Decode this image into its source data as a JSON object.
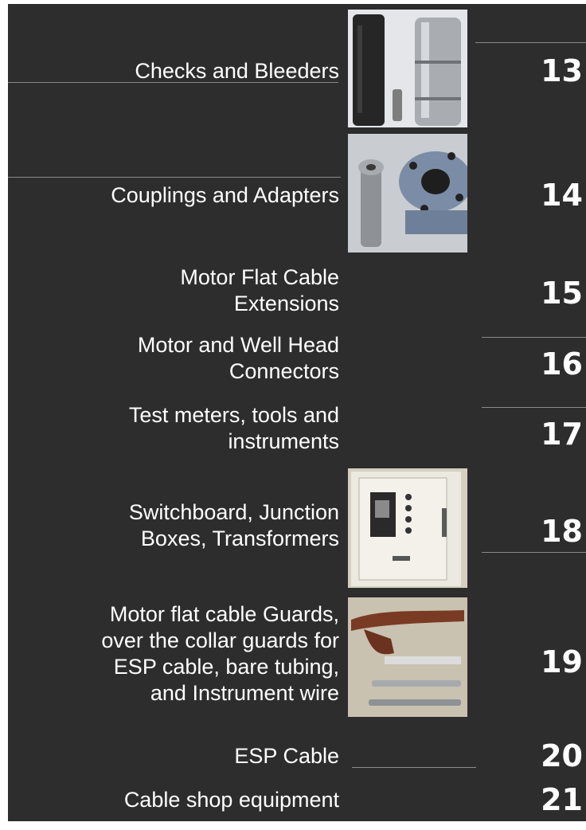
{
  "catalog": {
    "items": [
      {
        "title": "Checks and Bleeders",
        "page": "13",
        "photo": "check-valve-and-bleeder-parts"
      },
      {
        "title": "Couplings and Adapters",
        "page": "14",
        "photo": "coupling-and-flange-adapter"
      },
      {
        "title": "Motor Flat Cable\nExtensions",
        "page": "15"
      },
      {
        "title": "Motor and Well Head\nConnectors",
        "page": "16"
      },
      {
        "title": "Test meters, tools and\ninstruments",
        "page": "17"
      },
      {
        "title": "Switchboard, Junction\nBoxes, Transformers",
        "page": "18",
        "photo": "switchboard-panel"
      },
      {
        "title": "Motor flat cable Guards,\nover the collar guards for\nESP cable, bare tubing,\nand Instrument wire",
        "page": "19",
        "photo": "cable-guards"
      },
      {
        "title": "ESP Cable",
        "page": "20"
      },
      {
        "title": "Cable shop equipment",
        "page": "21"
      }
    ]
  }
}
